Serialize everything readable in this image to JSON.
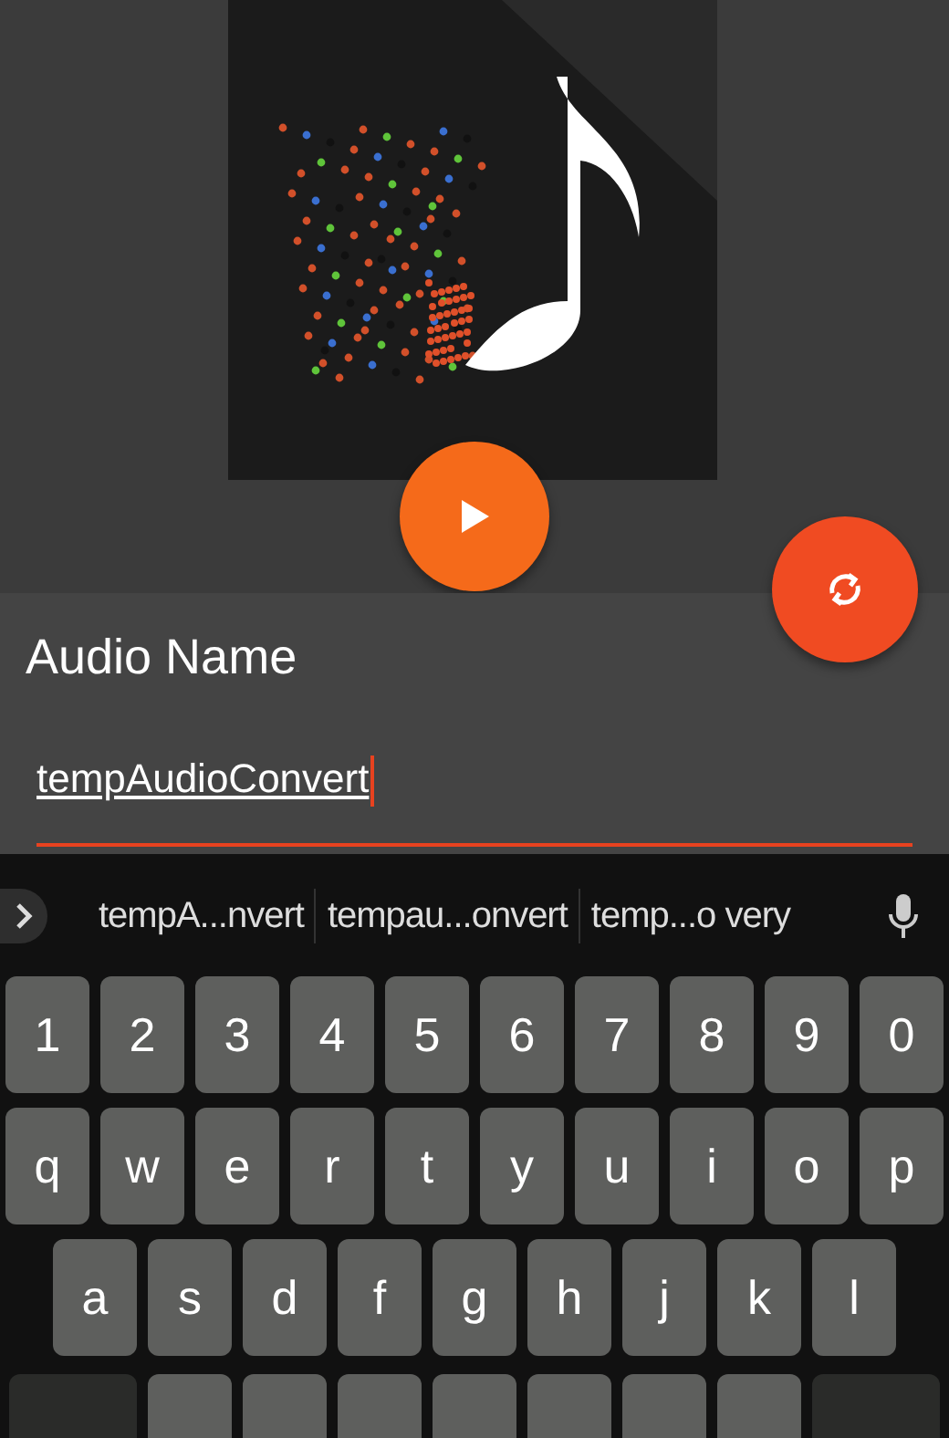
{
  "player": {
    "title_label": "Audio Name",
    "name_field": {
      "value": "tempAudioConvert",
      "focused": true
    }
  },
  "keyboard": {
    "suggestions": [
      "tempA...nvert",
      "tempau...onvert",
      "temp...o very"
    ],
    "rows": [
      [
        "1",
        "2",
        "3",
        "4",
        "5",
        "6",
        "7",
        "8",
        "9",
        "0"
      ],
      [
        "q",
        "w",
        "e",
        "r",
        "t",
        "y",
        "u",
        "i",
        "o",
        "p"
      ],
      [
        "a",
        "s",
        "d",
        "f",
        "g",
        "h",
        "j",
        "k",
        "l"
      ]
    ],
    "bottom_row_keys": [
      {
        "kind": "modifier"
      },
      {
        "kind": "letter"
      },
      {
        "kind": "letter"
      },
      {
        "kind": "letter"
      },
      {
        "kind": "letter"
      },
      {
        "kind": "letter"
      },
      {
        "kind": "letter"
      },
      {
        "kind": "letter"
      },
      {
        "kind": "modifier"
      }
    ]
  }
}
